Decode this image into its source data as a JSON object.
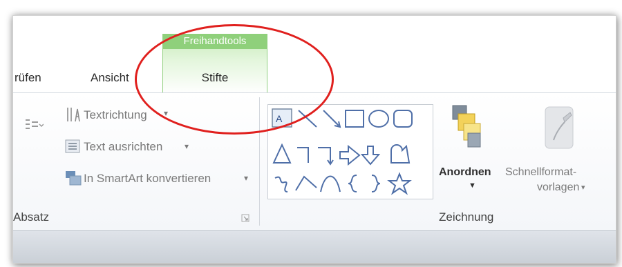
{
  "tabs": {
    "pruefen": "rüfen",
    "ansicht": "Ansicht",
    "context_band": "Freihandtools",
    "context_tab": "Stifte"
  },
  "absatz": {
    "textrichtung": "Textrichtung",
    "text_ausrichten": "Text ausrichten",
    "smartart": "In SmartArt konvertieren",
    "group_label": "Absatz"
  },
  "zeichnung": {
    "anordnen": "Anordnen",
    "schnellformat_line1": "Schnellformat-",
    "schnellformat_line2": "vorlagen",
    "group_label": "Zeichnung"
  },
  "colors": {
    "context_green": "#8fd07b",
    "highlight_red": "#e0201e"
  }
}
